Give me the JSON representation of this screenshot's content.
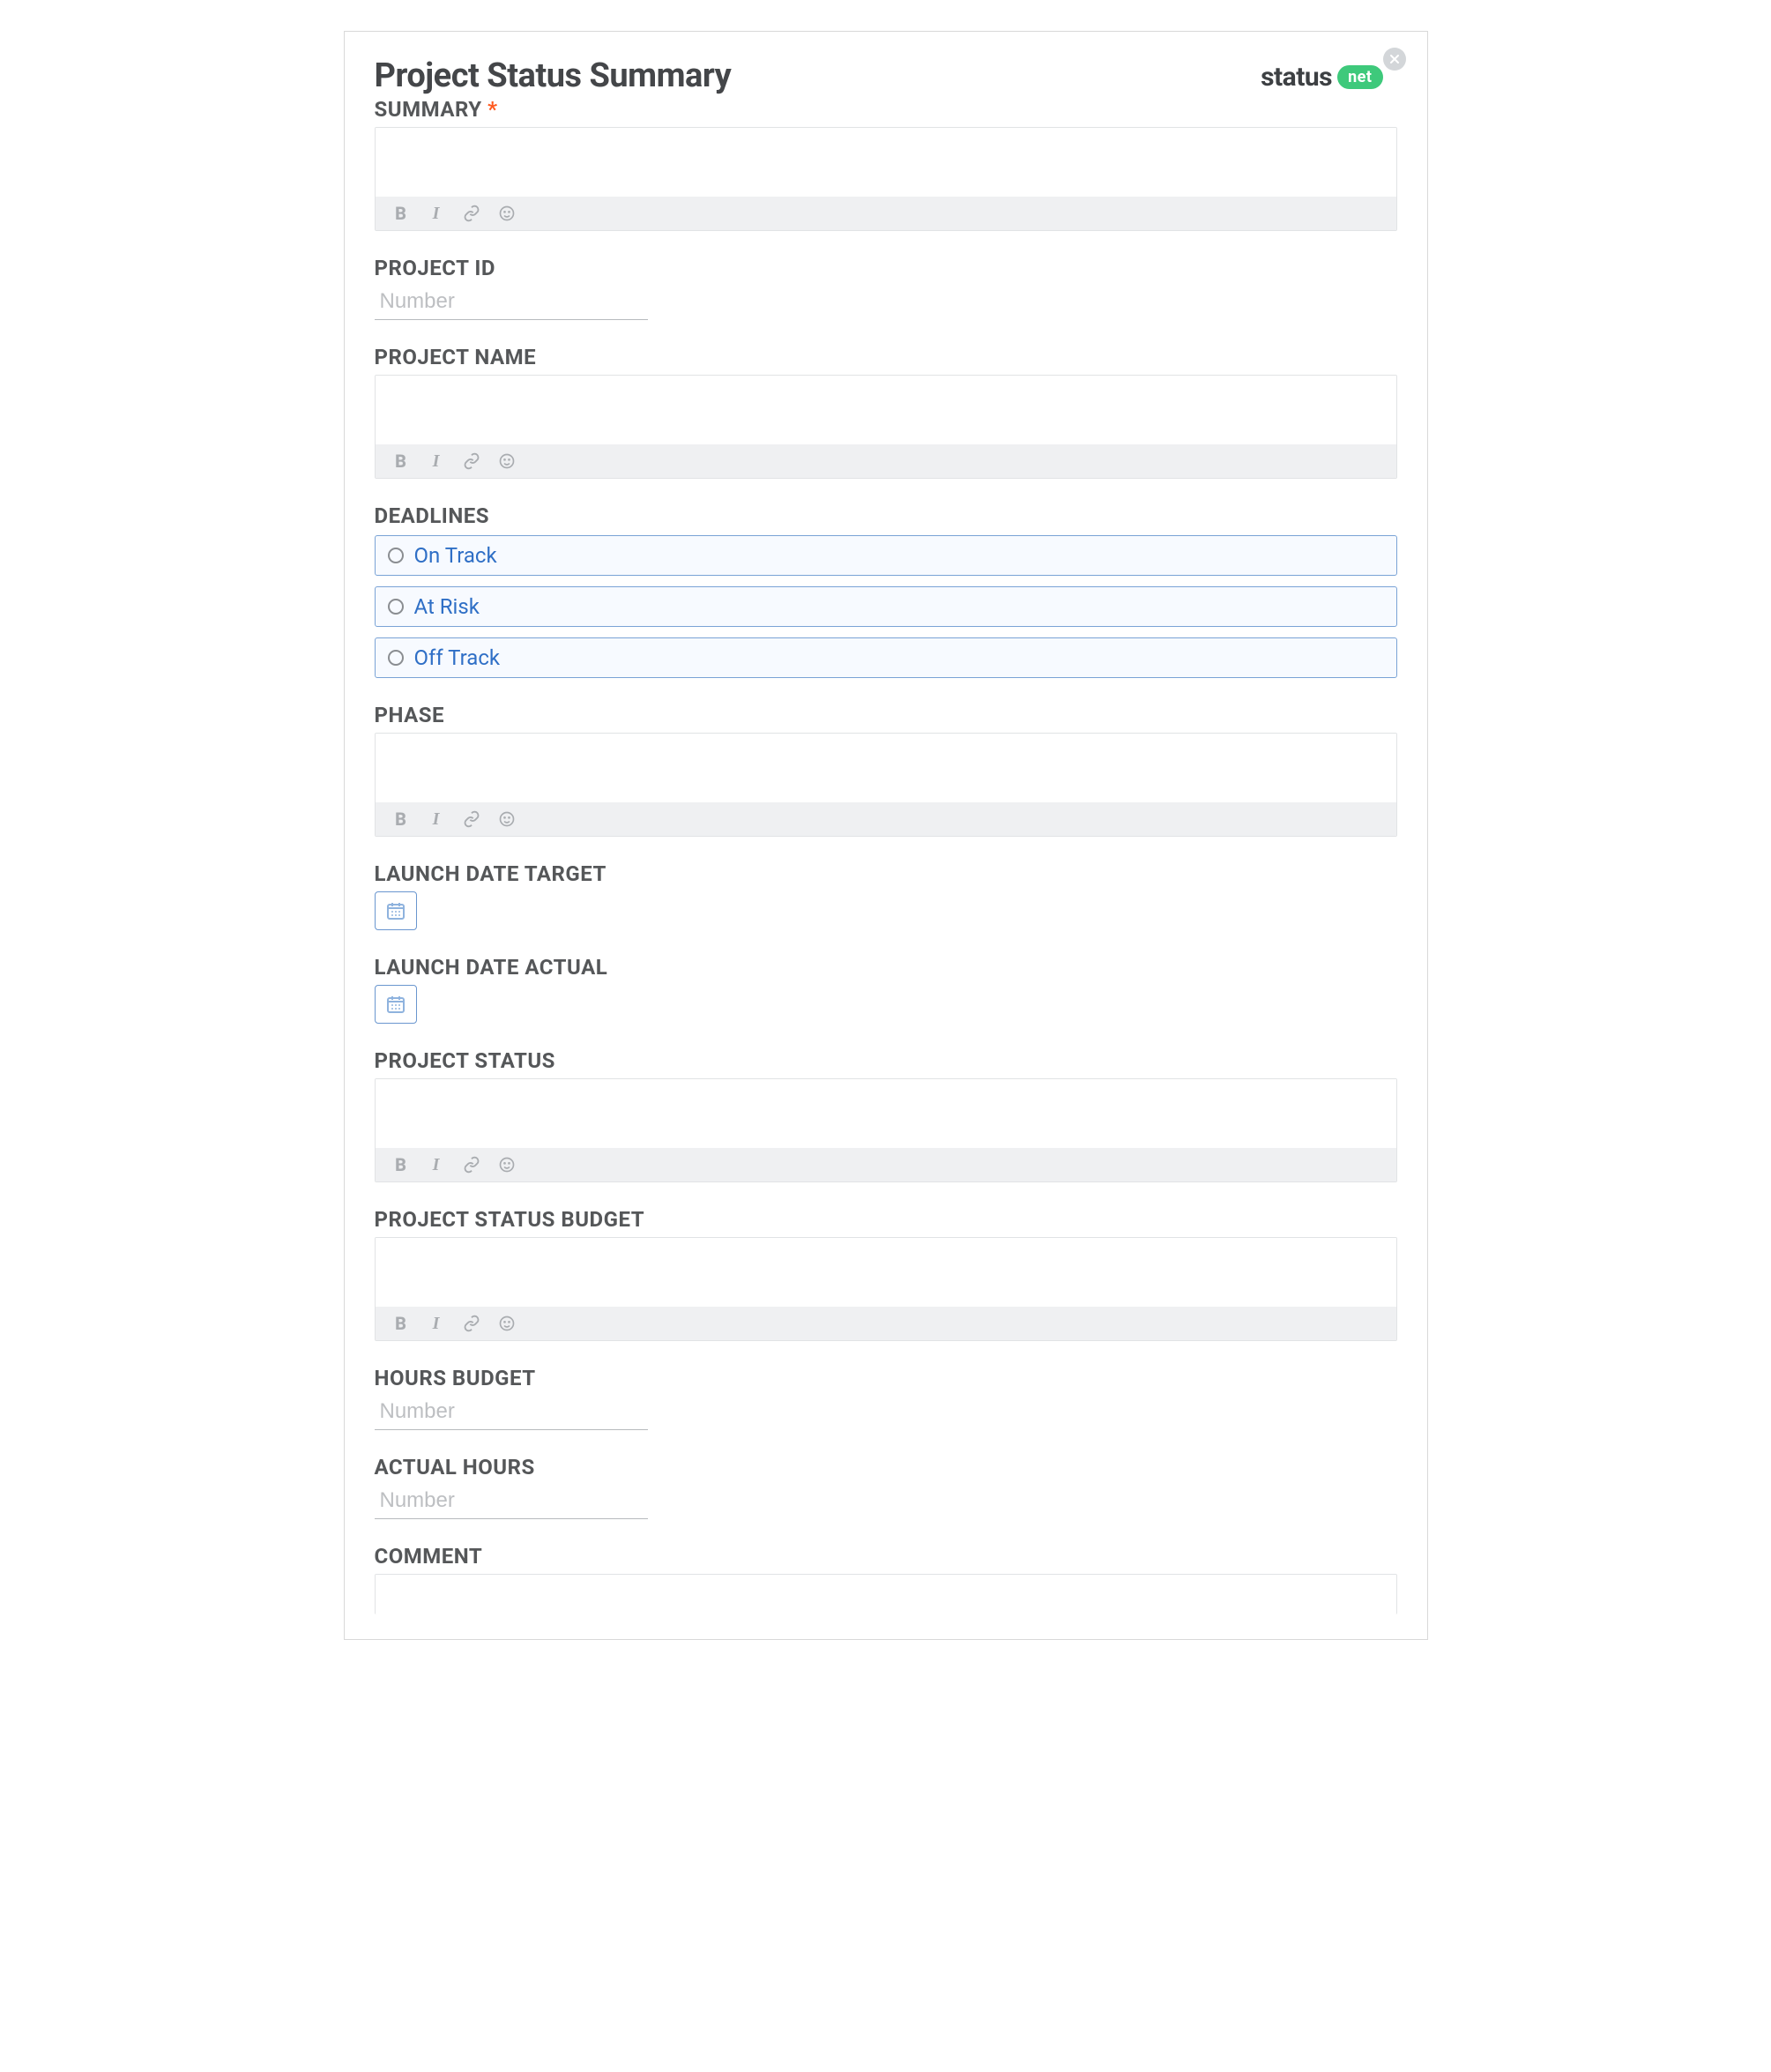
{
  "title": "Project Status Summary",
  "logo": {
    "text": "status",
    "badge": "net"
  },
  "fields": {
    "summary": {
      "label": "SUMMARY",
      "required": "*"
    },
    "project_id": {
      "label": "PROJECT ID",
      "placeholder": "Number"
    },
    "project_name": {
      "label": "PROJECT NAME"
    },
    "deadlines": {
      "label": "DEADLINES",
      "options": [
        "On Track",
        "At Risk",
        "Off Track"
      ]
    },
    "phase": {
      "label": "PHASE"
    },
    "launch_target": {
      "label": "LAUNCH DATE TARGET"
    },
    "launch_actual": {
      "label": "LAUNCH DATE ACTUAL"
    },
    "project_status": {
      "label": "PROJECT STATUS"
    },
    "project_status_budget": {
      "label": "PROJECT STATUS BUDGET"
    },
    "hours_budget": {
      "label": "HOURS BUDGET",
      "placeholder": "Number"
    },
    "actual_hours": {
      "label": "ACTUAL HOURS",
      "placeholder": "Number"
    },
    "comment": {
      "label": "COMMENT"
    }
  },
  "toolbar": {
    "bold": "B",
    "italic": "I"
  }
}
